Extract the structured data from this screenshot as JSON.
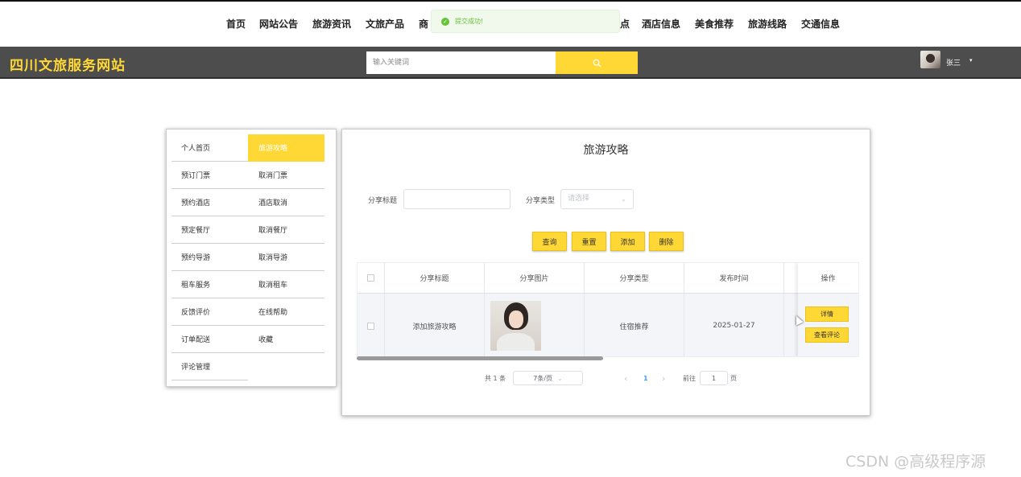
{
  "topnav": {
    "items": [
      "首页",
      "网站公告",
      "旅游资讯",
      "文旅产品",
      "商",
      "点",
      "酒店信息",
      "美食推荐",
      "旅游线路",
      "交通信息"
    ]
  },
  "toast": {
    "text": "提交成功!",
    "icon": "check-circle-icon",
    "color": "#67c23a"
  },
  "header": {
    "site_title": "四川文旅服务网站",
    "search_placeholder": "输入关键词",
    "search_icon": "search-icon",
    "username": "张三",
    "caret": "▾"
  },
  "colors": {
    "accent": "#ffd835",
    "header_bg": "#4d4d4d"
  },
  "sidebar": {
    "left": [
      "个人首页",
      "预订门票",
      "预约酒店",
      "预定餐厅",
      "预约导游",
      "租车服务",
      "反馈评价",
      "订单配送",
      "评论管理"
    ],
    "right": [
      "旅游攻略",
      "取消门票",
      "酒店取消",
      "取消餐厅",
      "取消导游",
      "取消租车",
      "在线帮助",
      "收藏"
    ]
  },
  "main": {
    "title": "旅游攻略",
    "filters": {
      "title_label": "分享标题",
      "type_label": "分享类型",
      "type_placeholder": "请选择"
    },
    "buttons": {
      "query": "查询",
      "reset": "重置",
      "add": "添加",
      "delete": "删除"
    },
    "table": {
      "headers": [
        "分享标题",
        "分享图片",
        "分享类型",
        "发布时间",
        "操作"
      ],
      "rows": [
        {
          "title": "添加旅游攻略",
          "image": "portrait-image",
          "type": "住宿推荐",
          "date": "2025-01-27"
        }
      ],
      "actions": {
        "detail": "详情",
        "comments": "查看评论"
      }
    },
    "pagination": {
      "total": "共 1 条",
      "page_size": "7条/页",
      "prev": "‹",
      "current": "1",
      "next": "›",
      "goto": "前往",
      "goto_value": "1",
      "page_suffix": "页"
    }
  },
  "watermark": "CSDN @高级程序源"
}
